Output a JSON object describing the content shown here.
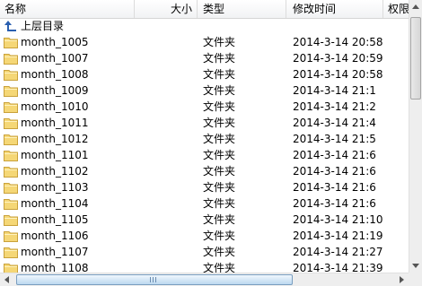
{
  "columns": {
    "name": "名称",
    "size": "大小",
    "type": "类型",
    "modified": "修改时间",
    "permissions": "权限"
  },
  "parent_dir": {
    "label": "上层目录",
    "icon": "up-arrow-icon"
  },
  "rows": [
    {
      "name": "month_1005",
      "type": "文件夹",
      "modified": "2014-3-14 20:58"
    },
    {
      "name": "month_1007",
      "type": "文件夹",
      "modified": "2014-3-14 20:59"
    },
    {
      "name": "month_1008",
      "type": "文件夹",
      "modified": "2014-3-14 20:58"
    },
    {
      "name": "month_1009",
      "type": "文件夹",
      "modified": "2014-3-14 21:1"
    },
    {
      "name": "month_1010",
      "type": "文件夹",
      "modified": "2014-3-14 21:2"
    },
    {
      "name": "month_1011",
      "type": "文件夹",
      "modified": "2014-3-14 21:4"
    },
    {
      "name": "month_1012",
      "type": "文件夹",
      "modified": "2014-3-14 21:5"
    },
    {
      "name": "month_1101",
      "type": "文件夹",
      "modified": "2014-3-14 21:6"
    },
    {
      "name": "month_1102",
      "type": "文件夹",
      "modified": "2014-3-14 21:6"
    },
    {
      "name": "month_1103",
      "type": "文件夹",
      "modified": "2014-3-14 21:6"
    },
    {
      "name": "month_1104",
      "type": "文件夹",
      "modified": "2014-3-14 21:6"
    },
    {
      "name": "month_1105",
      "type": "文件夹",
      "modified": "2014-3-14 21:10"
    },
    {
      "name": "month_1106",
      "type": "文件夹",
      "modified": "2014-3-14 21:19"
    },
    {
      "name": "month_1107",
      "type": "文件夹",
      "modified": "2014-3-14 21:27"
    },
    {
      "name": "month_1108",
      "type": "文件夹",
      "modified": "2014-3-14 21:39"
    }
  ],
  "colors": {
    "folder_fill": "#f5d776",
    "folder_stroke": "#c9a13a",
    "up_arrow": "#2a5fb0",
    "scroll_thumb": "#bcd8f0"
  }
}
